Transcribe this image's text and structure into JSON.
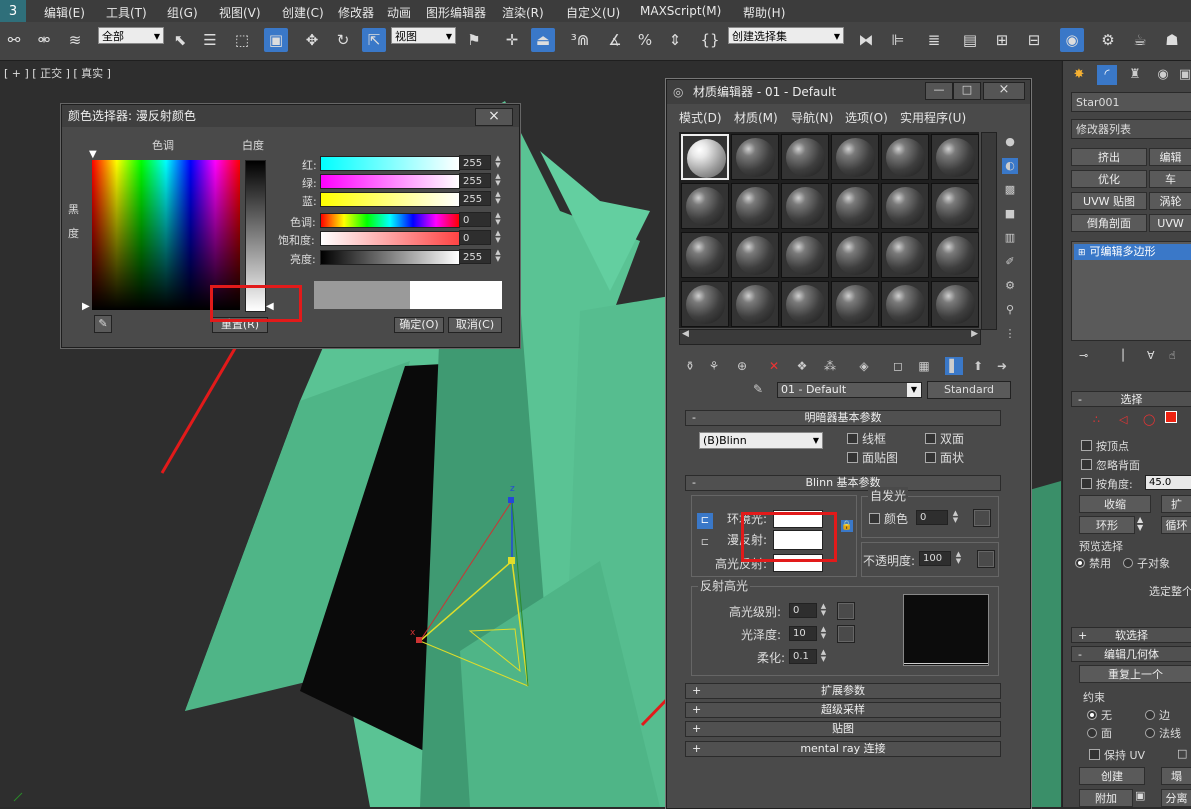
{
  "menubar": {
    "logo": "3",
    "items": [
      "编辑(E)",
      "工具(T)",
      "组(G)",
      "视图(V)",
      "创建(C)",
      "修改器",
      "动画",
      "图形编辑器",
      "渲染(R)",
      "自定义(U)",
      "MAXScript(M)",
      "帮助(H)"
    ]
  },
  "toolbar": {
    "selection_filter": "全部",
    "ref_coord": "视图",
    "named_selection": "创建选择集"
  },
  "viewport": {
    "label": "[ + ] [ 正交 ] [ 真实 ]",
    "colors": {
      "star": "#5ac394",
      "star_dark": "#3f9a72",
      "bg": "#2e2e2e"
    }
  },
  "color_picker": {
    "title": "颜色选择器: 漫反射颜色",
    "hue_label": "色调",
    "white_label": "白度",
    "black_label_top": "黑",
    "black_label_bottom": "度",
    "channels": [
      {
        "label": "红:",
        "value": "255"
      },
      {
        "label": "绿:",
        "value": "255"
      },
      {
        "label": "蓝:",
        "value": "255"
      },
      {
        "label": "色调:",
        "value": "0"
      },
      {
        "label": "饱和度:",
        "value": "0"
      },
      {
        "label": "亮度:",
        "value": "255"
      }
    ],
    "reset_button": "重置(R)",
    "ok_button": "确定(O)",
    "cancel_button": "取消(C)",
    "old_color": "#9a9a9a",
    "new_color": "#ffffff"
  },
  "material_editor": {
    "title": "材质编辑器 - 01 - Default",
    "menu": [
      "模式(D)",
      "材质(M)",
      "导航(N)",
      "选项(O)",
      "实用程序(U)"
    ],
    "material_name": "01 - Default",
    "material_type": "Standard",
    "shader_rollout": "明暗器基本参数",
    "shader": "(B)Blinn",
    "checkboxes": [
      "线框",
      "双面",
      "面贴图",
      "面状"
    ],
    "blinn_rollout": "Blinn 基本参数",
    "self_illum": {
      "group": "自发光",
      "color_label": "颜色",
      "value": "0"
    },
    "ambient_label": "环境光:",
    "diffuse_label": "漫反射:",
    "specular_label": "高光反射:",
    "opacity_label": "不透明度:",
    "opacity_value": "100",
    "spec_group": "反射高光",
    "spec_level_label": "高光级别:",
    "spec_level": "0",
    "glossiness_label": "光泽度:",
    "glossiness": "10",
    "soften_label": "柔化:",
    "soften": "0.1",
    "rollouts": [
      "扩展参数",
      "超级采样",
      "贴图",
      "mental ray 连接"
    ]
  },
  "command_panel": {
    "object_name": "Star001",
    "modifier_list": "修改器列表",
    "buttons": [
      "挤出",
      "编辑",
      "优化",
      "车",
      "UVW 贴图",
      "涡轮",
      "倒角剖面",
      "UVW"
    ],
    "stack_item": "可编辑多边形",
    "selection_rollout": "选择",
    "by_vertex": "按顶点",
    "ignore_backface": "忽略背面",
    "by_angle": "按角度:",
    "angle_value": "45.0",
    "shrink": "收缩",
    "grow": "扩",
    "ring": "环形",
    "loop": "循环",
    "preview_label": "预览选择",
    "preview_off": "禁用",
    "preview_sub": "子对象",
    "select_all": "选定整个",
    "soft_selection": "软选择",
    "edit_geometry": "编辑几何体",
    "repeat_last": "重复上一个",
    "constraints": "约束",
    "c_none": "无",
    "c_edge": "边",
    "c_face": "面",
    "c_normal": "法线",
    "preserve_uv": "保持 UV",
    "create": "创建",
    "collapse": "塌",
    "attach": "附加",
    "detach": "分离"
  }
}
